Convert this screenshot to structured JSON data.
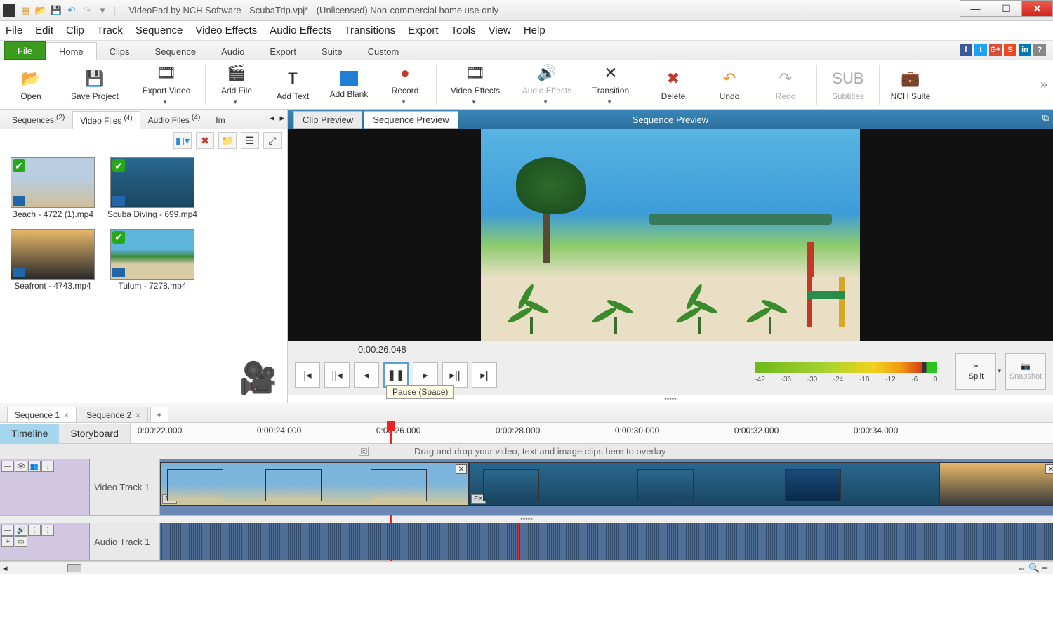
{
  "window": {
    "title": "VideoPad by NCH Software - ScubaTrip.vpj* - (Unlicensed) Non-commercial home use only"
  },
  "menu": [
    "File",
    "Edit",
    "Clip",
    "Track",
    "Sequence",
    "Video Effects",
    "Audio Effects",
    "Transitions",
    "Export",
    "Tools",
    "View",
    "Help"
  ],
  "ribbon_tabs": {
    "file": "File",
    "items": [
      "Home",
      "Clips",
      "Sequence",
      "Audio",
      "Export",
      "Suite",
      "Custom"
    ],
    "active": "Home"
  },
  "ribbon": {
    "open": "Open",
    "save": "Save Project",
    "export_video": "Export Video",
    "add_file": "Add File",
    "add_text": "Add Text",
    "add_blank": "Add Blank",
    "record": "Record",
    "video_effects": "Video Effects",
    "audio_effects": "Audio Effects",
    "transition": "Transition",
    "delete": "Delete",
    "undo": "Undo",
    "redo": "Redo",
    "subtitles": "Subtitles",
    "nch_suite": "NCH Suite"
  },
  "bin_tabs": [
    {
      "label": "Sequences",
      "count": "(2)"
    },
    {
      "label": "Video Files",
      "count": "(4)"
    },
    {
      "label": "Audio Files",
      "count": "(4)"
    },
    {
      "label": "Im",
      "count": ""
    }
  ],
  "bin_active": 1,
  "clips": [
    {
      "name": "Beach - 4722 (1).mp4"
    },
    {
      "name": "Scuba Diving - 699.mp4"
    },
    {
      "name": "Seafront - 4743.mp4"
    },
    {
      "name": "Tulum - 7278.mp4"
    }
  ],
  "preview": {
    "tabs": [
      "Clip Preview",
      "Sequence Preview"
    ],
    "active": 1,
    "title": "Sequence Preview",
    "timecode": "0:00:26.048",
    "tooltip": "Pause (Space)",
    "split": "Split",
    "snapshot": "Snapshot",
    "vu_labels": [
      "-42",
      "-36",
      "-30",
      "-24",
      "-18",
      "-12",
      "-6",
      "0"
    ]
  },
  "sequences": [
    "Sequence 1",
    "Sequence 2"
  ],
  "timeline": {
    "modes": [
      "Timeline",
      "Storyboard"
    ],
    "active": 0,
    "ticks": [
      "0:00:22.000",
      "0:00:24.000",
      "0:00:26.000",
      "0:00:28.000",
      "0:00:30.000",
      "0:00:32.000",
      "0:00:34.000"
    ],
    "overlay_hint": "Drag and drop your video, text and image clips here to overlay",
    "video_track": "Video Track 1",
    "audio_track": "Audio Track 1"
  }
}
